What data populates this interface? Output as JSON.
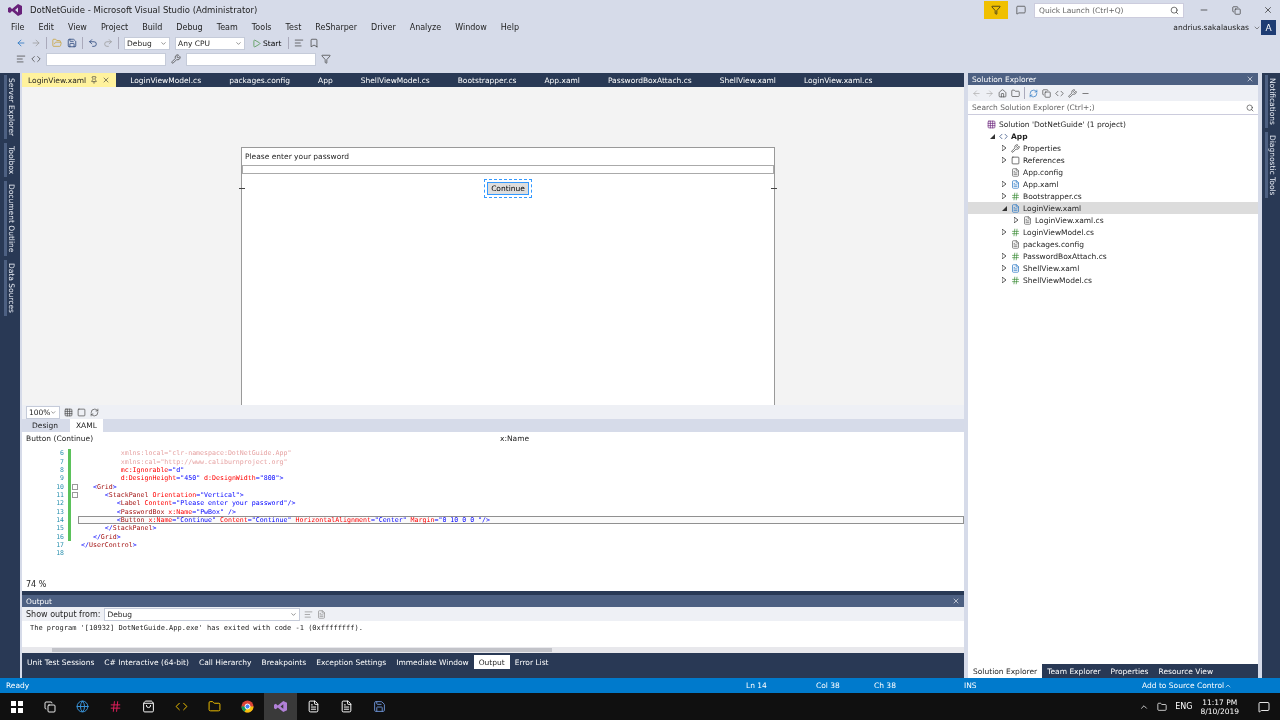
{
  "window": {
    "title": "DotNetGuide - Microsoft Visual Studio  (Administrator)",
    "quick_launch_placeholder": "Quick Launch (Ctrl+Q)",
    "user": "andrius.sakalauskas",
    "avatar": "A"
  },
  "menu": [
    "File",
    "Edit",
    "View",
    "Project",
    "Build",
    "Debug",
    "Team",
    "Tools",
    "Test",
    "ReSharper",
    "Driver",
    "Analyze",
    "Window",
    "Help"
  ],
  "toolbar": {
    "configuration": "Debug",
    "platform": "Any CPU",
    "start": "Start"
  },
  "left_side_tabs": [
    "Server Explorer",
    "Toolbox",
    "Document Outline",
    "Data Sources"
  ],
  "right_side_tabs": [
    "Notifications",
    "Diagnostic Tools"
  ],
  "document_tabs": [
    {
      "label": "LoginView.xaml",
      "selected": true
    },
    {
      "label": "LoginViewModel.cs",
      "selected": false
    },
    {
      "label": "packages.config",
      "selected": false
    },
    {
      "label": "App",
      "selected": false
    },
    {
      "label": "ShellViewModel.cs",
      "selected": false
    },
    {
      "label": "Bootstrapper.cs",
      "selected": false
    },
    {
      "label": "App.xaml",
      "selected": false
    },
    {
      "label": "PasswordBoxAttach.cs",
      "selected": false
    },
    {
      "label": "ShellView.xaml",
      "selected": false
    },
    {
      "label": "LoginView.xaml.cs",
      "selected": false
    }
  ],
  "designer": {
    "label": "Please enter your password",
    "button": "Continue",
    "button_selected": true,
    "zoom": "100%"
  },
  "view_tabs": [
    {
      "label": "Design",
      "selected": false
    },
    {
      "label": "XAML",
      "selected": true
    }
  ],
  "breadcrumb": {
    "element": "Button (Continue)",
    "member": "x:Name"
  },
  "code_lines": [
    {
      "n": "6",
      "changed": true,
      "fold": false,
      "current": false,
      "tokens": [
        {
          "kind": "dim",
          "text": "          xmlns:local=\"clr-namespace:DotNetGuide.App\""
        }
      ]
    },
    {
      "n": "7",
      "changed": true,
      "fold": false,
      "current": false,
      "tokens": [
        {
          "kind": "dim",
          "text": "          xmlns:cal=\"http://www.caliburnproject.org\""
        }
      ]
    },
    {
      "n": "8",
      "changed": true,
      "fold": false,
      "current": false,
      "tokens": [
        {
          "kind": "attr",
          "text": "          mc:Ignorable"
        },
        {
          "kind": "punct",
          "text": "="
        },
        {
          "kind": "value",
          "text": "\"d\""
        }
      ]
    },
    {
      "n": "9",
      "changed": true,
      "fold": false,
      "current": false,
      "tokens": [
        {
          "kind": "attr",
          "text": "          d:DesignHeight"
        },
        {
          "kind": "punct",
          "text": "="
        },
        {
          "kind": "value",
          "text": "\"450\" "
        },
        {
          "kind": "attr",
          "text": "d:DesignWidth"
        },
        {
          "kind": "punct",
          "text": "="
        },
        {
          "kind": "value",
          "text": "\"800\""
        },
        {
          "kind": "punct",
          "text": ">"
        }
      ]
    },
    {
      "n": "10",
      "changed": true,
      "fold": true,
      "current": false,
      "tokens": [
        {
          "kind": "punct",
          "text": "   <"
        },
        {
          "kind": "tag",
          "text": "Grid"
        },
        {
          "kind": "punct",
          "text": ">"
        }
      ]
    },
    {
      "n": "11",
      "changed": true,
      "fold": true,
      "current": false,
      "tokens": [
        {
          "kind": "punct",
          "text": "      <"
        },
        {
          "kind": "tag",
          "text": "StackPanel "
        },
        {
          "kind": "attr",
          "text": "Orientation"
        },
        {
          "kind": "punct",
          "text": "="
        },
        {
          "kind": "value",
          "text": "\"Vertical\""
        },
        {
          "kind": "punct",
          "text": ">"
        }
      ]
    },
    {
      "n": "12",
      "changed": true,
      "fold": false,
      "current": false,
      "tokens": [
        {
          "kind": "punct",
          "text": "         <"
        },
        {
          "kind": "tag",
          "text": "Label "
        },
        {
          "kind": "attr",
          "text": "Content"
        },
        {
          "kind": "punct",
          "text": "="
        },
        {
          "kind": "value",
          "text": "\"Please enter your password\""
        },
        {
          "kind": "punct",
          "text": "/>"
        }
      ]
    },
    {
      "n": "13",
      "changed": true,
      "fold": false,
      "current": false,
      "tokens": [
        {
          "kind": "punct",
          "text": "         <"
        },
        {
          "kind": "tag",
          "text": "PasswordBox "
        },
        {
          "kind": "attr",
          "text": "x:Name"
        },
        {
          "kind": "punct",
          "text": "="
        },
        {
          "kind": "value",
          "text": "\"PwBox\" "
        },
        {
          "kind": "punct",
          "text": "/>"
        }
      ]
    },
    {
      "n": "14",
      "changed": true,
      "fold": false,
      "current": true,
      "tokens": [
        {
          "kind": "punct",
          "text": "         <"
        },
        {
          "kind": "tag",
          "text": "Button "
        },
        {
          "kind": "attr",
          "text": "x:Name"
        },
        {
          "kind": "punct",
          "text": "="
        },
        {
          "kind": "value",
          "text": "\"Continue\" "
        },
        {
          "kind": "attr",
          "text": "Content"
        },
        {
          "kind": "punct",
          "text": "="
        },
        {
          "kind": "value",
          "text": "\"Continue\" "
        },
        {
          "kind": "attr",
          "text": "HorizontalAlignment"
        },
        {
          "kind": "punct",
          "text": "="
        },
        {
          "kind": "value",
          "text": "\"Center\" "
        },
        {
          "kind": "attr",
          "text": "Margin"
        },
        {
          "kind": "punct",
          "text": "="
        },
        {
          "kind": "value",
          "text": "\"0 10 0 0 \""
        },
        {
          "kind": "punct",
          "text": "/>"
        }
      ]
    },
    {
      "n": "15",
      "changed": true,
      "fold": false,
      "current": false,
      "tokens": [
        {
          "kind": "punct",
          "text": "      </"
        },
        {
          "kind": "tag",
          "text": "StackPanel"
        },
        {
          "kind": "punct",
          "text": ">"
        }
      ]
    },
    {
      "n": "16",
      "changed": true,
      "fold": false,
      "current": false,
      "tokens": [
        {
          "kind": "punct",
          "text": "   </"
        },
        {
          "kind": "tag",
          "text": "Grid"
        },
        {
          "kind": "punct",
          "text": ">"
        }
      ]
    },
    {
      "n": "17",
      "changed": false,
      "fold": false,
      "current": false,
      "tokens": [
        {
          "kind": "punct",
          "text": "</"
        },
        {
          "kind": "tag",
          "text": "UserControl"
        },
        {
          "kind": "punct",
          "text": ">"
        }
      ]
    },
    {
      "n": "18",
      "changed": false,
      "fold": false,
      "current": false
    }
  ],
  "code_zoom": "74 %",
  "output": {
    "title": "Output",
    "show_from_label": "Show output from:",
    "source": "Debug",
    "text": "The program '[10932] DotNetGuide.App.exe' has exited with code -1 (0xffffffff)."
  },
  "bottom_tabs": [
    {
      "label": "Unit Test Sessions",
      "selected": false
    },
    {
      "label": "C# Interactive (64-bit)",
      "selected": false
    },
    {
      "label": "Call Hierarchy",
      "selected": false
    },
    {
      "label": "Breakpoints",
      "selected": false
    },
    {
      "label": "Exception Settings",
      "selected": false
    },
    {
      "label": "Immediate Window",
      "selected": false
    },
    {
      "label": "Output",
      "selected": true
    },
    {
      "label": "Error List",
      "selected": false
    }
  ],
  "solution_explorer": {
    "title": "Solution Explorer",
    "search_placeholder": "Search Solution Explorer (Ctrl+;)",
    "tree": [
      {
        "label": "Solution 'DotNetGuide' (1 project)",
        "kind": "solution",
        "expandable": false,
        "selected": false,
        "children": [
          {
            "label": "App",
            "kind": "project",
            "expandable": true,
            "expanded": true,
            "selected": false,
            "children": [
              {
                "label": "Properties",
                "kind": "properties",
                "expandable": true,
                "expanded": false,
                "selected": false
              },
              {
                "label": "References",
                "kind": "references",
                "expandable": true,
                "expanded": false,
                "selected": false
              },
              {
                "label": "App.config",
                "kind": "config",
                "expandable": false,
                "selected": false
              },
              {
                "label": "App.xaml",
                "kind": "xaml",
                "expandable": true,
                "expanded": false,
                "selected": false
              },
              {
                "label": "Bootstrapper.cs",
                "kind": "cs",
                "expandable": true,
                "expanded": false,
                "selected": false
              },
              {
                "label": "LoginView.xaml",
                "kind": "xaml",
                "expandable": true,
                "expanded": true,
                "selected": true,
                "children": [
                  {
                    "label": "LoginView.xaml.cs",
                    "kind": "codefile",
                    "expandable": true,
                    "expanded": false,
                    "selected": false
                  }
                ]
              },
              {
                "label": "LoginViewModel.cs",
                "kind": "cs",
                "expandable": true,
                "expanded": false,
                "selected": false
              },
              {
                "label": "packages.config",
                "kind": "config",
                "expandable": false,
                "selected": false
              },
              {
                "label": "PasswordBoxAttach.cs",
                "kind": "cs",
                "expandable": true,
                "expanded": false,
                "selected": false
              },
              {
                "label": "ShellView.xaml",
                "kind": "xaml",
                "expandable": true,
                "expanded": false,
                "selected": false
              },
              {
                "label": "ShellViewModel.cs",
                "kind": "cs",
                "expandable": true,
                "expanded": false,
                "selected": false
              }
            ]
          }
        ]
      }
    ],
    "tabs": [
      {
        "label": "Solution Explorer",
        "selected": true
      },
      {
        "label": "Team Explorer",
        "selected": false
      },
      {
        "label": "Properties",
        "selected": false
      },
      {
        "label": "Resource View",
        "selected": false
      }
    ]
  },
  "status_bar": {
    "state": "Ready",
    "line": "Ln 14",
    "col": "Col 38",
    "ch": "Ch 38",
    "mode": "INS",
    "source_control": "Add to Source Control"
  },
  "taskbar": {
    "language": "ENG",
    "time": "11:17 PM",
    "date": "8/10/2019"
  }
}
